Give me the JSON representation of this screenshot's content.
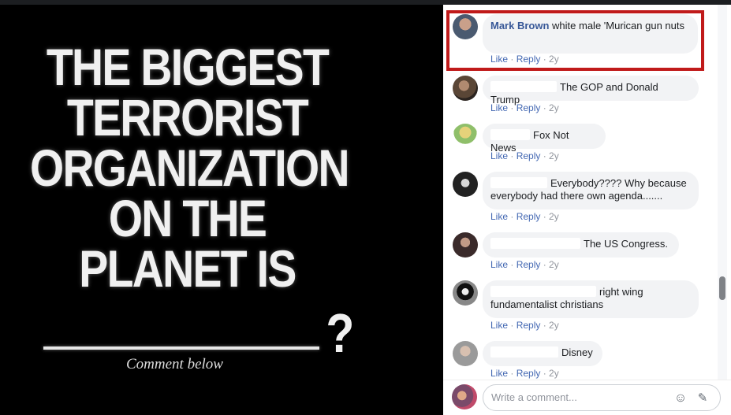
{
  "meme": {
    "lines": [
      "THE BIGGEST",
      "TERRORIST",
      "ORGANIZATION",
      "ON THE",
      "PLANET IS"
    ],
    "question_mark": "?",
    "caption": "Comment below"
  },
  "comments": [
    {
      "author": "Mark Brown",
      "text": "white male 'Murican gun nuts",
      "actions": {
        "like": "Like",
        "reply": "Reply",
        "time": "2y"
      }
    },
    {
      "author": "",
      "text": "The GOP and Donald Trump",
      "actions": {
        "like": "Like",
        "reply": "Reply",
        "time": "2y"
      }
    },
    {
      "author": "",
      "text": "Fox Not News",
      "actions": {
        "like": "Like",
        "reply": "Reply",
        "time": "2y"
      }
    },
    {
      "author": "",
      "text": "Everybody???? Why because everybody had there own agenda.......",
      "actions": {
        "like": "Like",
        "reply": "Reply",
        "time": "2y"
      }
    },
    {
      "author": "",
      "text": "The US Congress.",
      "actions": {
        "like": "Like",
        "reply": "Reply",
        "time": "2y"
      }
    },
    {
      "author": "",
      "text": "right wing fundamentalist christians",
      "actions": {
        "like": "Like",
        "reply": "Reply",
        "time": "2y"
      }
    },
    {
      "author": "",
      "text": "Disney",
      "actions": {
        "like": "Like",
        "reply": "Reply",
        "time": "2y"
      }
    }
  ],
  "composer": {
    "placeholder": "Write a comment...",
    "emoji_icon": "smiley-icon",
    "sticker_icon": "sticker-icon"
  },
  "colors": {
    "highlight": "#c01a1a",
    "link": "#4267b2",
    "author": "#385898",
    "bubble": "#f2f3f5"
  }
}
